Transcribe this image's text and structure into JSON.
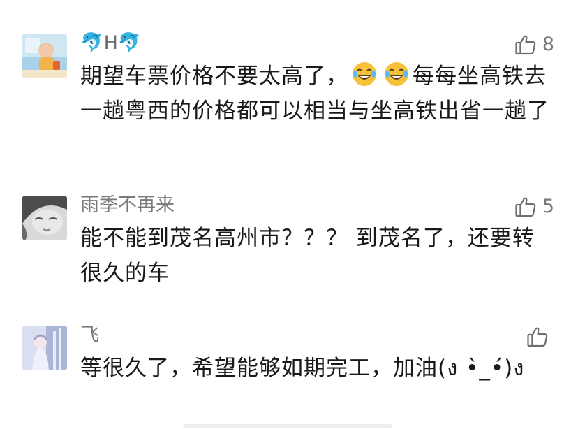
{
  "comments": [
    {
      "nickname": "🐬H🐬",
      "likes": "8",
      "text_before_emoji": "期望车票价格不要太高了，",
      "emoji_icon": "laughing-crying-face",
      "text_after_emoji": "每每坐高铁去一趟粤西的价格都可以相当与坐高铁出省一趟了"
    },
    {
      "nickname": "雨季不再来",
      "likes": "5",
      "text": "能不能到茂名高州市？？？ 到茂名了，还要转很久的车"
    },
    {
      "nickname": "飞",
      "likes": "",
      "text": "等很久了，希望能够如期完工，加油(ง •̀_•́)ง"
    }
  ],
  "colors": {
    "text": "#191919",
    "meta": "#7a7a7a",
    "background": "#ffffff"
  }
}
